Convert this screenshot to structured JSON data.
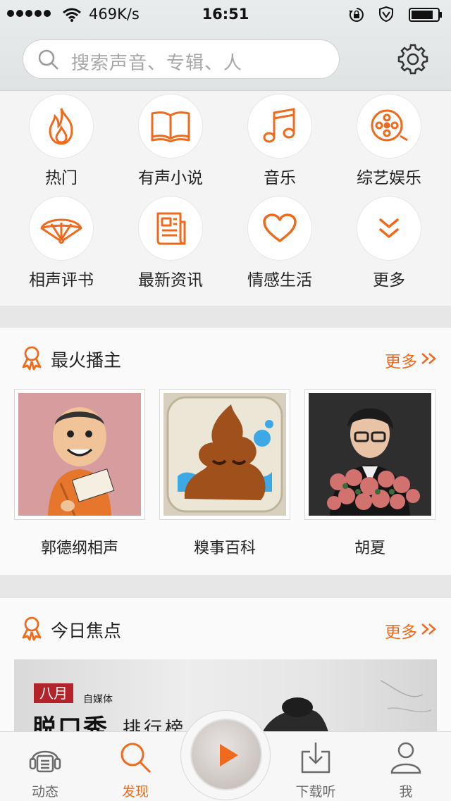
{
  "status_bar": {
    "net_speed": "469K/s",
    "time": "16:51"
  },
  "search": {
    "placeholder": "搜索声音、专辑、人"
  },
  "categories": [
    {
      "label": "热门",
      "icon": "flame-icon"
    },
    {
      "label": "有声小说",
      "icon": "book-icon"
    },
    {
      "label": "音乐",
      "icon": "music-note-icon"
    },
    {
      "label": "综艺娱乐",
      "icon": "film-reel-icon"
    },
    {
      "label": "相声评书",
      "icon": "fan-icon"
    },
    {
      "label": "最新资讯",
      "icon": "newspaper-icon"
    },
    {
      "label": "情感生活",
      "icon": "heart-icon"
    },
    {
      "label": "更多",
      "icon": "double-chevron-down-icon"
    }
  ],
  "top_hosts": {
    "title": "最火播主",
    "more": "更多",
    "items": [
      {
        "name": "郭德纲相声"
      },
      {
        "name": "糗事百科"
      },
      {
        "name": "胡夏"
      }
    ]
  },
  "today_focus": {
    "title": "今日焦点",
    "more": "更多",
    "banner": {
      "tag": "八月",
      "subtitle": "自媒体",
      "title": "脱口秀",
      "title_suffix": "排行榜"
    }
  },
  "tabbar": {
    "tabs": [
      {
        "label": "动态",
        "icon": "radio-headphones-icon",
        "active": false
      },
      {
        "label": "发现",
        "icon": "search-icon",
        "active": true
      },
      {
        "label": "下载听",
        "icon": "download-icon",
        "active": false
      },
      {
        "label": "我",
        "icon": "person-icon",
        "active": false
      }
    ]
  },
  "colors": {
    "accent": "#f06a1e",
    "tab_inactive": "#6b6b6b"
  }
}
